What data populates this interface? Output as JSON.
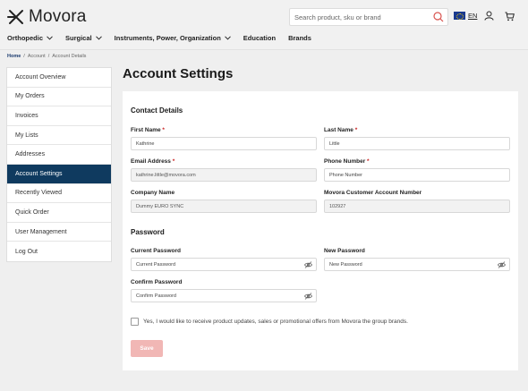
{
  "brand": {
    "name": "Movora"
  },
  "search": {
    "placeholder": "Search product, sku or brand"
  },
  "lang": {
    "code": "EN"
  },
  "nav": [
    {
      "label": "Orthopedic"
    },
    {
      "label": "Surgical"
    },
    {
      "label": "Instruments, Power, Organization"
    },
    {
      "label": "Education"
    },
    {
      "label": "Brands"
    }
  ],
  "breadcrumb": {
    "home": "Home",
    "sep": "/",
    "account": "Account",
    "current": "Account Details"
  },
  "sidebar": {
    "items": [
      {
        "label": "Account Overview"
      },
      {
        "label": "My Orders"
      },
      {
        "label": "Invoices"
      },
      {
        "label": "My Lists"
      },
      {
        "label": "Addresses"
      },
      {
        "label": "Account Settings",
        "active": true
      },
      {
        "label": "Recently Viewed"
      },
      {
        "label": "Quick Order"
      },
      {
        "label": "User Management"
      },
      {
        "label": "Log Out"
      }
    ]
  },
  "page": {
    "title": "Account Settings"
  },
  "contact": {
    "title": "Contact Details",
    "first_name": {
      "label": "First Name",
      "value": "Kathrine"
    },
    "last_name": {
      "label": "Last Name",
      "value": "Little"
    },
    "email": {
      "label": "Email Address",
      "value": "kathrine.little@movora.com"
    },
    "phone": {
      "label": "Phone Number",
      "value": "Phone Number"
    },
    "company": {
      "label": "Company Name",
      "value": "Dummy EURO SYNC"
    },
    "account_number": {
      "label": "Movora Customer Account Number",
      "value": "102927"
    }
  },
  "password": {
    "title": "Password",
    "current": {
      "label": "Current Password",
      "placeholder": "Current Password"
    },
    "new": {
      "label": "New Password",
      "placeholder": "New Password"
    },
    "confirm": {
      "label": "Confirm Password",
      "placeholder": "Confirm Password"
    }
  },
  "consent": {
    "label": "Yes, I would like to receive product updates, sales or promotional offers from Movora the group brands."
  },
  "actions": {
    "save": "Save"
  },
  "colors": {
    "accent": "#0f3a5f",
    "required": "#c81e1e",
    "save_disabled": "#f1b7b5",
    "search_icon": "#d9534f"
  }
}
